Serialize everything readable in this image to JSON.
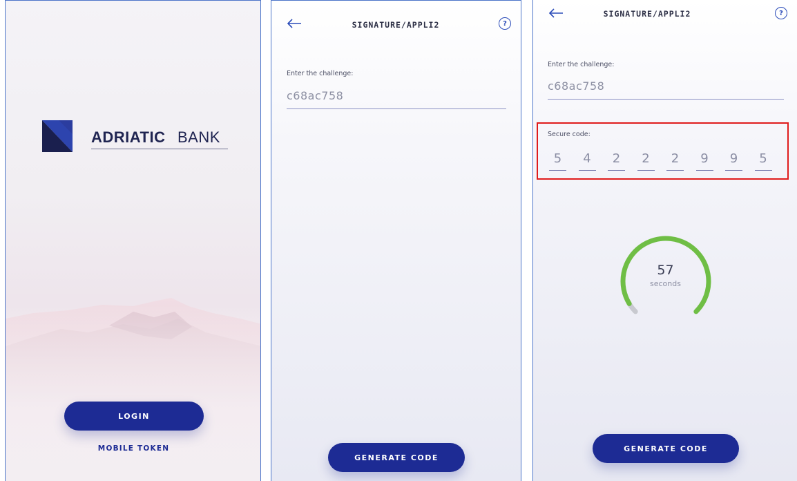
{
  "login_screen": {
    "brand_bold": "ADRIATIC",
    "brand_regular": "BANK",
    "login_button": "LOGIN",
    "mobile_token_link": "MOBILE TOKEN"
  },
  "signature_screen": {
    "title": "SIGNATURE/APPLI2",
    "help_symbol": "?",
    "challenge_label": "Enter the challenge:",
    "challenge_value": "c68ac758",
    "generate_button": "GENERATE CODE"
  },
  "code_screen": {
    "title": "SIGNATURE/APPLI2",
    "help_symbol": "?",
    "challenge_label": "Enter the challenge:",
    "challenge_value": "c68ac758",
    "secure_code_label": "Secure code:",
    "secure_code_digits": [
      "5",
      "4",
      "2",
      "2",
      "2",
      "9",
      "9",
      "5"
    ],
    "timer_value": "57",
    "timer_unit": "seconds",
    "timer_remaining_fraction": 0.95,
    "generate_button": "GENERATE CODE"
  },
  "colors": {
    "primary": "#1d2b94",
    "highlight_border": "#e01b1b",
    "timer_green": "#6fbe45",
    "timer_gray": "#c8c9cf"
  },
  "icons": [
    "back-arrow-icon",
    "help-icon",
    "logo-icon"
  ]
}
